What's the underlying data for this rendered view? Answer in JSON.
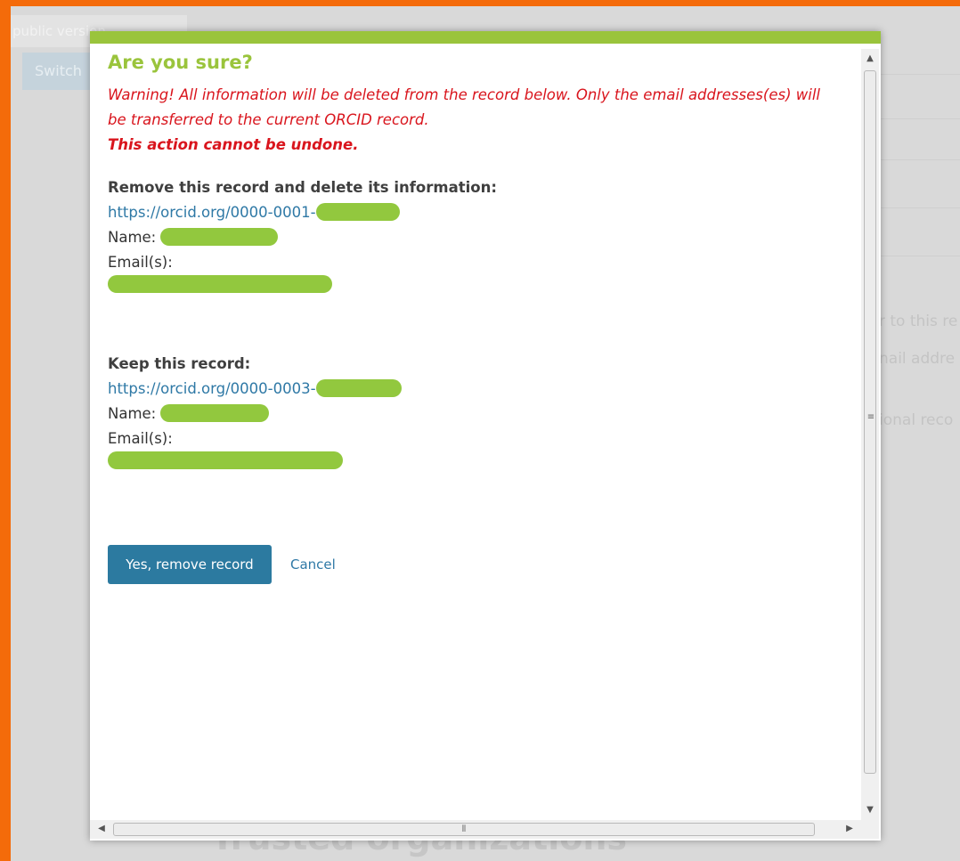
{
  "background": {
    "tab_text": "public version",
    "switch_label": "Switch",
    "right_snippets": [
      "r to this re",
      "nail addre",
      "ional reco"
    ],
    "bottom_heading": "Trusted organizations"
  },
  "modal": {
    "title": "Are you sure?",
    "warning_line1": "Warning! All information will be deleted from the record below. Only the email addresses(es) will",
    "warning_line2": "be transferred to the current ORCID record.",
    "warning_strong": "This action cannot be undone.",
    "remove_section": {
      "heading": "Remove this record and delete its information:",
      "orcid_url": "https://orcid.org/0000-0001-",
      "name_label": "Name: ",
      "emails_label": "Email(s):"
    },
    "keep_section": {
      "heading": "Keep this record:",
      "orcid_url": "https://orcid.org/0000-0003-",
      "name_label": "Name: ",
      "emails_label": "Email(s):"
    },
    "confirm_button": "Yes, remove record",
    "cancel_link": "Cancel"
  },
  "colors": {
    "accent_green": "#9ac43c",
    "warning_red": "#d9151d",
    "link_blue": "#2f79a6",
    "button_blue": "#2c7aa0",
    "frame_orange": "#f46b0a",
    "redaction_green": "#92c83e"
  }
}
